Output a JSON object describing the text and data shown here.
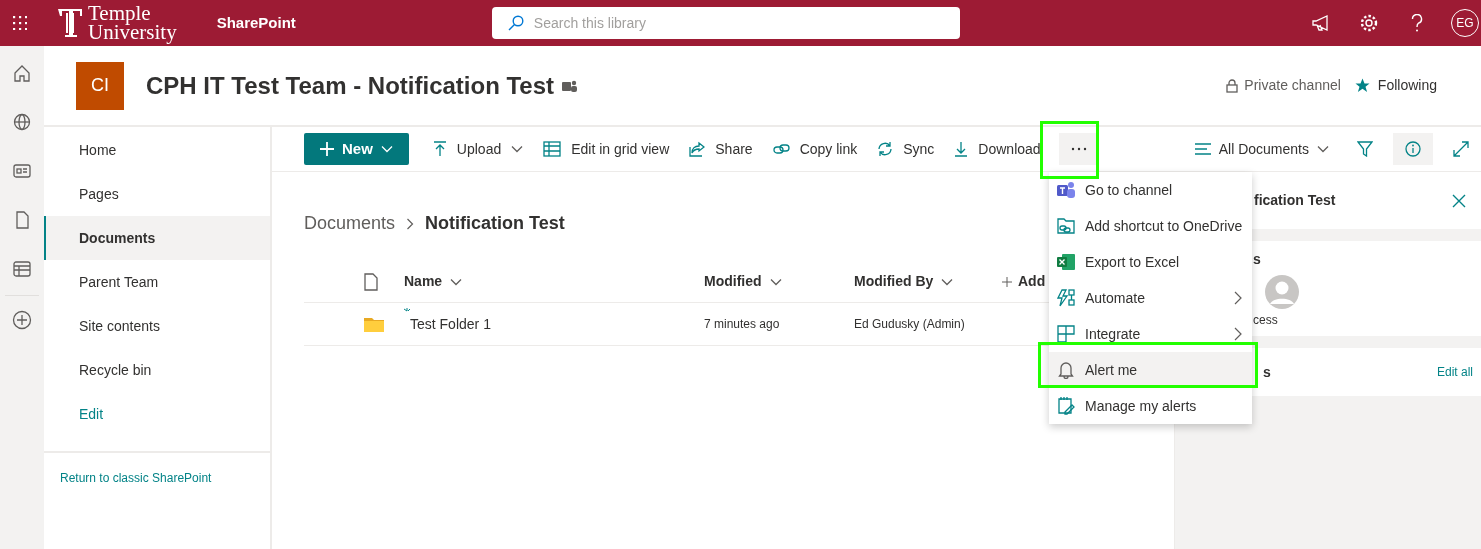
{
  "top_bar": {
    "brand": [
      "Temple",
      "University"
    ],
    "app": "SharePoint",
    "search": {
      "placeholder": "Search this library"
    },
    "avatar": "EG"
  },
  "site": {
    "logo": "CI",
    "title": "CPH IT Test Team - Notification Test",
    "privacy": "Private channel",
    "following": "Following"
  },
  "nav": {
    "items": [
      {
        "label": "Home",
        "selected": false,
        "kind": "link"
      },
      {
        "label": "Pages",
        "selected": false,
        "kind": "link"
      },
      {
        "label": "Documents",
        "selected": true,
        "kind": "link"
      },
      {
        "label": "Parent Team",
        "selected": false,
        "kind": "link"
      },
      {
        "label": "Site contents",
        "selected": false,
        "kind": "link"
      },
      {
        "label": "Recycle bin",
        "selected": false,
        "kind": "link"
      },
      {
        "label": "Edit",
        "selected": false,
        "kind": "edit"
      }
    ],
    "footer_link": "Return to classic SharePoint"
  },
  "command_bar": {
    "items": [
      {
        "label": "New",
        "kind": "primary"
      },
      {
        "label": "Upload",
        "kind": "dropdown"
      },
      {
        "label": "Edit in grid view",
        "kind": "plain"
      },
      {
        "label": "Share",
        "kind": "plain"
      },
      {
        "label": "Copy link",
        "kind": "plain"
      },
      {
        "label": "Sync",
        "kind": "plain"
      },
      {
        "label": "Download",
        "kind": "plain"
      }
    ],
    "view": "All Documents"
  },
  "breadcrumb": [
    "Documents",
    "Notification Test"
  ],
  "table": {
    "columns": [
      "Name",
      "Modified",
      "Modified By",
      "Add"
    ],
    "rows": [
      {
        "name": "Test Folder 1",
        "modified": "7 minutes ago",
        "modified_by": "Ed Gudusky (Admin)"
      }
    ]
  },
  "menu": {
    "items": [
      {
        "label": "Go to channel",
        "submenu": false,
        "selected": false
      },
      {
        "label": "Add shortcut to OneDrive",
        "submenu": false,
        "selected": false
      },
      {
        "label": "Export to Excel",
        "submenu": false,
        "selected": false
      },
      {
        "label": "Automate",
        "submenu": true,
        "selected": false
      },
      {
        "label": "Integrate",
        "submenu": true,
        "selected": false
      },
      {
        "label": "Alert me",
        "submenu": false,
        "selected": true
      },
      {
        "label": "Manage my alerts",
        "submenu": false,
        "selected": false
      }
    ]
  },
  "details_panel": {
    "title": "fication Test",
    "section_1": "s",
    "person": "cess",
    "section_2": "s",
    "edit_all": "Edit all"
  }
}
